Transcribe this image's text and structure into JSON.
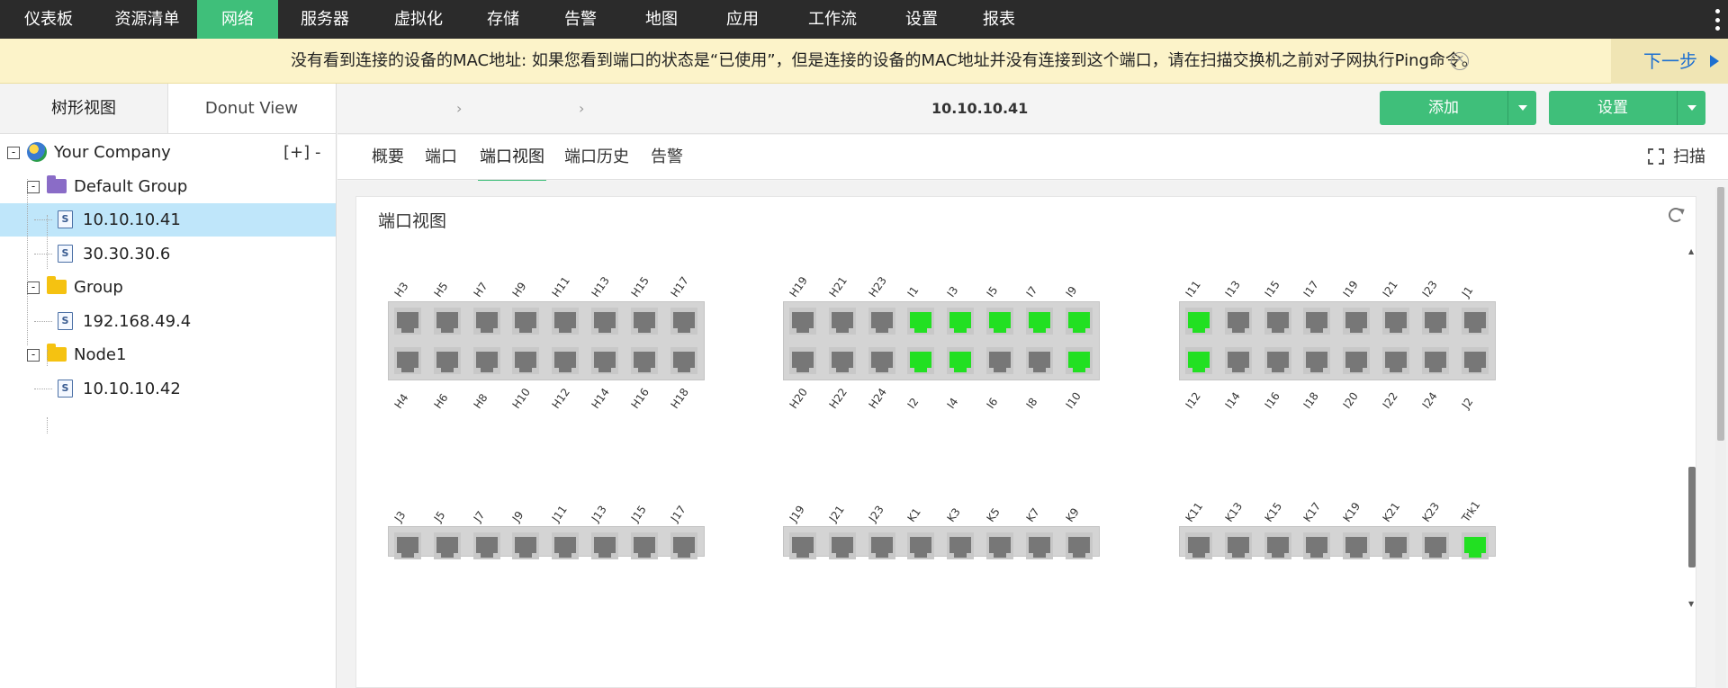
{
  "topnav": {
    "items": [
      {
        "label": "仪表板"
      },
      {
        "label": "资源清单"
      },
      {
        "label": "网络",
        "active": true
      },
      {
        "label": "服务器"
      },
      {
        "label": "虚拟化"
      },
      {
        "label": "存储"
      },
      {
        "label": "告警"
      },
      {
        "label": "地图"
      },
      {
        "label": "应用"
      },
      {
        "label": "工作流"
      },
      {
        "label": "设置"
      },
      {
        "label": "报表"
      }
    ],
    "more_icon": "kebab-menu-icon"
  },
  "notice": {
    "message": "没有看到连接的设备的MAC地址: 如果您看到端口的状态是“已使用”，但是连接的设备的MAC地址并没有连接到这个端口，请在扫描交换机之前对子网执行Ping命令。",
    "next_label": "下一步"
  },
  "left_panel": {
    "tabs": [
      {
        "label": "树形视图",
        "active": true
      },
      {
        "label": "Donut View"
      }
    ],
    "tree": [
      {
        "label": "Your Company",
        "type": "root",
        "expander": "-"
      },
      {
        "label": "Default Group",
        "type": "folder",
        "color": "#8a6cc7",
        "expander": "-"
      },
      {
        "label": "10.10.10.41",
        "type": "device",
        "selected": true
      },
      {
        "label": "30.30.30.6",
        "type": "device"
      },
      {
        "label": "Group",
        "type": "folder",
        "color": "#f5c211",
        "expander": "-"
      },
      {
        "label": "192.168.49.4",
        "type": "device"
      },
      {
        "label": "Node1",
        "type": "folder",
        "color": "#f5c211",
        "expander": "-"
      },
      {
        "label": "10.10.10.42",
        "type": "device"
      }
    ],
    "tree_actions": {
      "expand": "[+]",
      "collapse": "-"
    }
  },
  "header": {
    "breadcrumb_current": "10.10.10.41",
    "add_label": "添加",
    "settings_label": "设置"
  },
  "subtabs": {
    "items": [
      {
        "label": "概要"
      },
      {
        "label": "端口"
      },
      {
        "label": "端口视图",
        "active": true
      },
      {
        "label": "端口历史"
      },
      {
        "label": "告警"
      }
    ],
    "scan_label": "扫描"
  },
  "panel": {
    "title": "端口视图",
    "accent_color": "#3fbf7a",
    "port_up_color": "#22e022",
    "port_down_color": "#777777",
    "blocks": [
      {
        "top": [
          "H3",
          "H5",
          "H7",
          "H9",
          "H11",
          "H13",
          "H15",
          "H17"
        ],
        "bottom": [
          "H4",
          "H6",
          "H8",
          "H10",
          "H12",
          "H14",
          "H16",
          "H18"
        ],
        "top_up": [],
        "bottom_up": []
      },
      {
        "top": [
          "H19",
          "H21",
          "H23",
          "I1",
          "I3",
          "I5",
          "I7",
          "I9"
        ],
        "bottom": [
          "H20",
          "H22",
          "H24",
          "I2",
          "I4",
          "I6",
          "I8",
          "I10"
        ],
        "top_up": [
          "I1",
          "I3",
          "I5",
          "I7",
          "I9"
        ],
        "bottom_up": [
          "I2",
          "I4",
          "I10"
        ]
      },
      {
        "top": [
          "I11",
          "I13",
          "I15",
          "I17",
          "I19",
          "I21",
          "I23",
          "J1"
        ],
        "bottom": [
          "I12",
          "I14",
          "I16",
          "I18",
          "I20",
          "I22",
          "I24",
          "J2"
        ],
        "top_up": [
          "I11"
        ],
        "bottom_up": [
          "I12"
        ]
      },
      {
        "top": [
          "J3",
          "J5",
          "J7",
          "J9",
          "J11",
          "J13",
          "J15",
          "J17"
        ],
        "bottom": [],
        "top_up": [],
        "bottom_up": []
      },
      {
        "top": [
          "J19",
          "J21",
          "J23",
          "K1",
          "K3",
          "K5",
          "K7",
          "K9"
        ],
        "bottom": [],
        "top_up": [],
        "bottom_up": []
      },
      {
        "top": [
          "K11",
          "K13",
          "K15",
          "K17",
          "K19",
          "K21",
          "K23",
          "Trk1"
        ],
        "bottom": [],
        "top_up": [
          "Trk1"
        ],
        "bottom_up": []
      }
    ]
  }
}
